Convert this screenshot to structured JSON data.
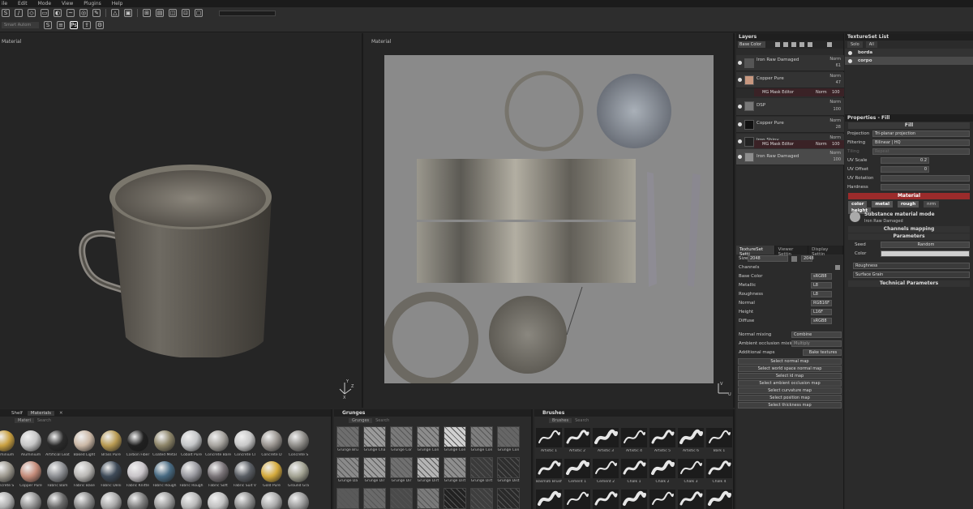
{
  "menu": [
    "ile",
    "Edit",
    "Mode",
    "View",
    "Plugins",
    "Help"
  ],
  "toolbar": {
    "smart_label": "Smart Autom"
  },
  "viewport3d": {
    "title": "Material"
  },
  "viewport2d": {
    "title": "Material"
  },
  "axis": {
    "x": "X",
    "y": "Y",
    "z": "Z",
    "u": "U",
    "v": "V"
  },
  "layers": {
    "title": "Layers",
    "channel": "Base Color",
    "items": [
      {
        "name": "Iron Raw Damaged",
        "mode": "Norm",
        "opacity": "61"
      },
      {
        "name": "Copper Pure",
        "mode": "Norm",
        "opacity": "47"
      },
      {
        "name": "MG Mask Editor",
        "mode": "Norm",
        "opacity": "100"
      },
      {
        "name": "DSP",
        "mode": "Norm",
        "opacity": "100"
      },
      {
        "name": "Copper Pure",
        "mode": "Norm",
        "opacity": "28"
      },
      {
        "name": "Iron Shiny",
        "mode": "Norm",
        "opacity": "100"
      },
      {
        "name": "MG Mask Editor",
        "mode": "Norm",
        "opacity": "100"
      },
      {
        "name": "Iron Raw Damaged",
        "mode": "Norm",
        "opacity": "100"
      }
    ]
  },
  "texset": {
    "tabs": [
      "TextureSet Setti",
      "Viewer Settin",
      "Display Settin"
    ],
    "size_label": "Size",
    "size_value": "2048",
    "size_extra": "2048",
    "channels_label": "Channels",
    "channels": [
      {
        "name": "Base Color",
        "fmt": "sRGB8"
      },
      {
        "name": "Metallic",
        "fmt": "L8"
      },
      {
        "name": "Roughness",
        "fmt": "L8"
      },
      {
        "name": "Normal",
        "fmt": "RGB16F"
      },
      {
        "name": "Height",
        "fmt": "L16F"
      },
      {
        "name": "Diffuse",
        "fmt": "sRGB8"
      }
    ],
    "normal_mixing_label": "Normal mixing",
    "normal_mixing": "Combine",
    "ao_mixing_label": "Ambient occlusion mixing",
    "ao_mixing": "Multiply",
    "additional_maps": "Additional maps",
    "bake_button": "Bake textures",
    "map_buttons": [
      "Select normal map",
      "Select world space normal map",
      "Select id map",
      "Select ambient occlusion map",
      "Select curvature map",
      "Select position map",
      "Select thickness map"
    ]
  },
  "tslist": {
    "title": "TextureSet List",
    "solo": "Solo",
    "all": "All",
    "items": [
      "borda",
      "corpo"
    ]
  },
  "props": {
    "title": "Properties - Fill",
    "fill_header": "Fill",
    "projection_label": "Projection",
    "projection": "Tri-planar projection",
    "filtering_label": "Filtering",
    "filtering": "Bilinear | HQ",
    "tiling_label": "Tiling",
    "tiling": "Repeat",
    "uvscale_label": "UV Scale",
    "uvscale": "0.2",
    "uvoffset_label": "UV Offset",
    "uvoffset": "0",
    "uvrotation_label": "UV Rotation",
    "hardness_label": "Hardness",
    "material_header": "Material",
    "channels": [
      "color",
      "metal",
      "rough",
      "nrm",
      "height"
    ],
    "mode_title": "Substance material mode",
    "mode_sub": "Iron Raw Damaged",
    "channels_mapping": "Channels mapping",
    "parameters": "Parameters",
    "seed_label": "Seed",
    "seed_value": "Random",
    "color_label": "Color",
    "roughness_label": "Roughness",
    "surface_grain": "Surface Grain",
    "technical": "Technical Parameters"
  },
  "shelf": {
    "tabs": [
      "Shelf",
      "Materials"
    ],
    "filter": "Materi",
    "search": "Search",
    "materials": [
      {
        "name": "Aluminium",
        "color": "#c9a040"
      },
      {
        "name": "Aluminium",
        "color": "#c6c6c6"
      },
      {
        "name": "Artificial Leat",
        "color": "#2a2a2a"
      },
      {
        "name": "Baked Light",
        "color": "#cbb8a6"
      },
      {
        "name": "Brass Pure",
        "color": "#b89a52"
      },
      {
        "name": "Carbon Fiber",
        "color": "#202020"
      },
      {
        "name": "Coated Metal",
        "color": "#8c8468"
      },
      {
        "name": "Cobalt Pure",
        "color": "#c4c6c8"
      },
      {
        "name": "Concrete Bare",
        "color": "#a6a39e"
      },
      {
        "name": "Concrete Cl",
        "color": "#c8c8c8"
      },
      {
        "name": "Concrete D",
        "color": "#9a9590"
      },
      {
        "name": "Concrete S",
        "color": "#8e8c88"
      },
      {
        "name": "Concrete S",
        "color": "#9c988e"
      },
      {
        "name": "Copper Pure",
        "color": "#c38a78"
      },
      {
        "name": "Fabric Bam",
        "color": "#8c8e92"
      },
      {
        "name": "Fabric Base",
        "color": "#b9b7b4"
      },
      {
        "name": "Fabric Deni",
        "color": "#3e4a58"
      },
      {
        "name": "Fabric Knitte",
        "color": "#c8c4c8"
      },
      {
        "name": "Fabric Rough",
        "color": "#486a82"
      },
      {
        "name": "Fabric Rough",
        "color": "#9a9aa0"
      },
      {
        "name": "Fabric Soft",
        "color": "#7a7478"
      },
      {
        "name": "Fabric Suit V",
        "color": "#5a5e64"
      },
      {
        "name": "Gold Pure",
        "color": "#d4aa3c"
      },
      {
        "name": "Ground Gra",
        "color": "#a2a292"
      },
      {
        "name": "",
        "color": "#b0b0b0"
      },
      {
        "name": "",
        "color": "#909090"
      },
      {
        "name": "",
        "color": "#6a6a6a"
      },
      {
        "name": "",
        "color": "#8a8a8a"
      },
      {
        "name": "",
        "color": "#a8a8a8"
      },
      {
        "name": "",
        "color": "#7e7e7e"
      },
      {
        "name": "",
        "color": "#9c9c9c"
      },
      {
        "name": "",
        "color": "#b8b8b8"
      },
      {
        "name": "",
        "color": "#c0c0c0"
      },
      {
        "name": "",
        "color": "#8e8e8e"
      },
      {
        "name": "",
        "color": "#aaaaaa"
      },
      {
        "name": "",
        "color": "#9a9a9a"
      }
    ]
  },
  "grunges": {
    "title": "Grunges",
    "filter": "Grunges",
    "search": "Search",
    "items": [
      {
        "name": "Grunge Bru",
        "tone": "#6e6e6e"
      },
      {
        "name": "Grunge Cha",
        "tone": "#9a9a9a"
      },
      {
        "name": "Grunge Cor",
        "tone": "#7a7a7a"
      },
      {
        "name": "Grunge Con",
        "tone": "#8c8c8c"
      },
      {
        "name": "Grunge Con",
        "tone": "#d0d0d0"
      },
      {
        "name": "Grunge Con",
        "tone": "#7e7e7e"
      },
      {
        "name": "Grunge Con",
        "tone": "#666666"
      },
      {
        "name": "Grunge Da",
        "tone": "#8a8a8a"
      },
      {
        "name": "Grunge Dir",
        "tone": "#9e9e9e"
      },
      {
        "name": "Grunge Dir",
        "tone": "#707070"
      },
      {
        "name": "Grunge Dirt",
        "tone": "#b4b4b4"
      },
      {
        "name": "Grunge Dirt",
        "tone": "#8e8e8e"
      },
      {
        "name": "Grunge Dirt",
        "tone": "#3a3a3a"
      },
      {
        "name": "Grunge Dist",
        "tone": "#2e2e2e"
      },
      {
        "name": "",
        "tone": "#5a5a5a"
      },
      {
        "name": "",
        "tone": "#6a6a6a"
      },
      {
        "name": "",
        "tone": "#4a4a4a"
      },
      {
        "name": "",
        "tone": "#7a7a7a"
      },
      {
        "name": "",
        "tone": "#222222"
      },
      {
        "name": "",
        "tone": "#3e3e3e"
      },
      {
        "name": "",
        "tone": "#2a2a2a"
      }
    ]
  },
  "brushes": {
    "title": "Brushes",
    "filter": "Brushes",
    "search": "Search",
    "items": [
      "Artistic 1",
      "Artistic 2",
      "Artistic 3",
      "Artistic 4",
      "Artistic 5",
      "Artistic 6",
      "Bark 1",
      "Basmati Brush",
      "Cement 1",
      "Cement 2",
      "Chalk 1",
      "Chalk 2",
      "Chalk 3",
      "Chalk 4",
      "",
      "",
      "",
      "",
      "",
      "",
      ""
    ]
  }
}
